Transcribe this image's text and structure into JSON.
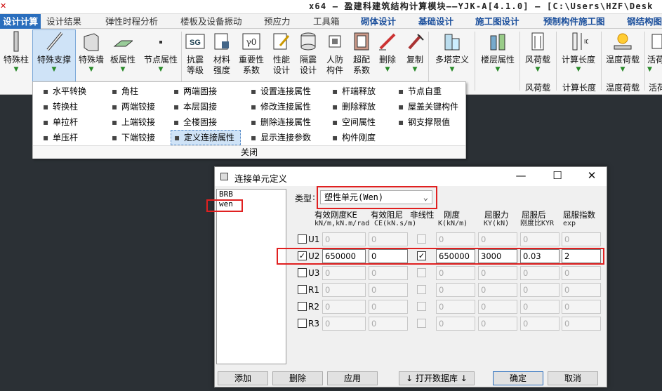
{
  "window": {
    "title": "x64 – 盈建科建筑结构计算模块——YJK-A[4.1.0] – [C:\\Users\\HZF\\Desk"
  },
  "menu": [
    "设计计算",
    "设计结果",
    "弹性时程分析",
    "楼板及设备振动",
    "预应力",
    "工具箱",
    "砌体设计",
    "基础设计",
    "施工图设计",
    "预制构件施工图",
    "钢结构图"
  ],
  "ribbon": {
    "buttons": [
      "特殊柱",
      "特殊支撑",
      "特殊墙",
      "板属性",
      "节点属性",
      "抗震\n等级",
      "材料\n强度",
      "重要性\n系数",
      "性能\n设计",
      "隔震\n设计",
      "人防\n构件",
      "超配\n系数",
      "删除",
      "复制",
      "多塔定义",
      "楼层属性",
      "风荷载",
      "计算长度",
      "温度荷载",
      "活荷"
    ],
    "group_labels": [
      "风荷载",
      "计算长度",
      "温度荷载",
      "活荷"
    ]
  },
  "dropdown": {
    "col1": [
      "水平转换",
      "转换柱",
      "单拉杆",
      "单压杆"
    ],
    "col2": [
      "角柱",
      "两端铰接",
      "上端铰接",
      "下端铰接"
    ],
    "col3": [
      "两端固接",
      "本层固接",
      "全楼固接",
      "定义连接属性"
    ],
    "col4": [
      "设置连接属性",
      "修改连接属性",
      "删除连接属性",
      "显示连接参数"
    ],
    "col5": [
      "杆端释放",
      "删除释放",
      "空间属性",
      "构件刚度"
    ],
    "col6": [
      "节点自重",
      "屋盖关键构件",
      "钢支撑限值"
    ],
    "close": "关闭"
  },
  "dialog": {
    "title": "连接单元定义",
    "list": [
      "BRB",
      "wen"
    ],
    "type_label": "类型",
    "type_value": "塑性单元(Wen)",
    "headers": [
      "有效刚度KE",
      "有效阻尼",
      "非线性",
      "刚度",
      "屈服力",
      "屈服后",
      "屈服指数"
    ],
    "subheaders": [
      "kN/m,kN.m/rad",
      "CE(kN.s/m)",
      "K(kN/m)",
      "KY(kN)",
      "刚度比KYR",
      "exp"
    ],
    "rows": [
      {
        "label": "U1",
        "checked": false,
        "nl": false,
        "v": [
          "0",
          "0",
          "0",
          "0",
          "0",
          "0"
        ]
      },
      {
        "label": "U2",
        "checked": true,
        "nl": true,
        "v": [
          "650000",
          "0",
          "650000",
          "3000",
          "0.03",
          "2"
        ]
      },
      {
        "label": "U3",
        "checked": false,
        "nl": false,
        "v": [
          "0",
          "0",
          "0",
          "0",
          "0",
          "0"
        ]
      },
      {
        "label": "R1",
        "checked": false,
        "nl": false,
        "v": [
          "0",
          "0",
          "0",
          "0",
          "0",
          "0"
        ]
      },
      {
        "label": "R2",
        "checked": false,
        "nl": false,
        "v": [
          "0",
          "0",
          "0",
          "0",
          "0",
          "0"
        ]
      },
      {
        "label": "R3",
        "checked": false,
        "nl": false,
        "v": [
          "0",
          "0",
          "0",
          "0",
          "0",
          "0"
        ]
      }
    ],
    "buttons": {
      "add": "添加",
      "delete": "删除",
      "apply": "应用",
      "open_db": "↓ 打开数据库 ↓",
      "ok": "确定",
      "cancel": "取消"
    }
  }
}
